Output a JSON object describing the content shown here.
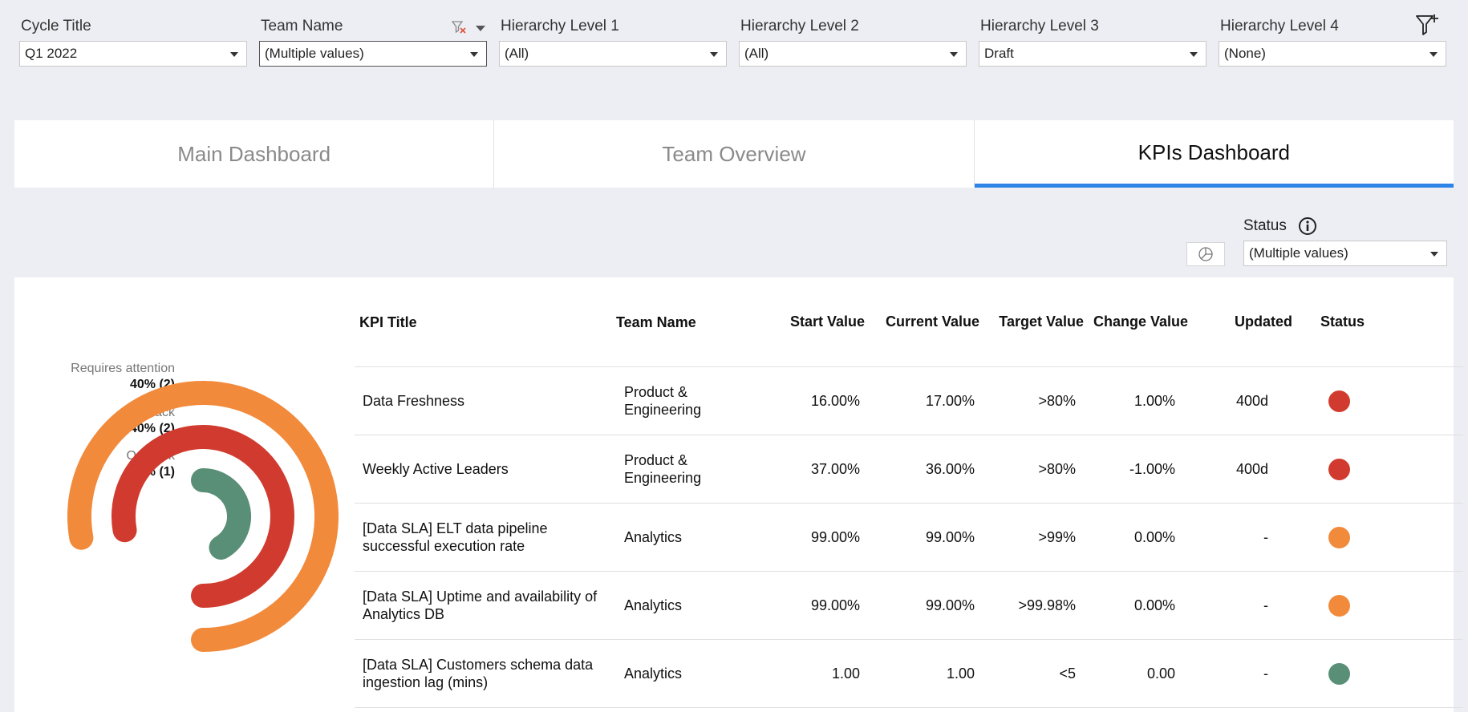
{
  "filters": [
    {
      "label": "Cycle Title",
      "value": "Q1 2022"
    },
    {
      "label": "Team Name",
      "value": "(Multiple values)"
    },
    {
      "label": "Hierarchy Level 1",
      "value": "(All)"
    },
    {
      "label": "Hierarchy Level 2",
      "value": "(All)"
    },
    {
      "label": "Hierarchy Level 3",
      "value": "Draft"
    },
    {
      "label": "Hierarchy Level 4",
      "value": "(None)"
    }
  ],
  "tabs": [
    {
      "label": "Main Dashboard",
      "active": false
    },
    {
      "label": "Team Overview",
      "active": false
    },
    {
      "label": "KPIs Dashboard",
      "active": true
    }
  ],
  "status_filter": {
    "label": "Status",
    "value": "(Multiple values)"
  },
  "colors": {
    "requires_attention": "#f28a3c",
    "off_track": "#d13b2f",
    "on_track": "#5a8f77",
    "tab_accent": "#2d83e6"
  },
  "chart_data": {
    "type": "radial-bar",
    "series": [
      {
        "name": "Requires attention",
        "label": "40% (2)",
        "percent": 40,
        "count": 2,
        "color": "#f28a3c"
      },
      {
        "name": "Off track",
        "label": "40% (2)",
        "percent": 40,
        "count": 2,
        "color": "#d13b2f"
      },
      {
        "name": "On track",
        "label": "20% (1)",
        "percent": 20,
        "count": 1,
        "color": "#5a8f77"
      }
    ]
  },
  "table": {
    "headers": {
      "title": "KPI Title",
      "team": "Team Name",
      "start": "Start Value",
      "current": "Current Value",
      "target": "Target Value",
      "change": "Change Value",
      "updated": "Updated",
      "status": "Status"
    },
    "rows": [
      {
        "title": "Data Freshness",
        "team": "Product & Engineering",
        "start": "16.00%",
        "current": "17.00%",
        "target": ">80%",
        "change": "1.00%",
        "updated": "400d",
        "status": "Off track",
        "color": "#d13b2f"
      },
      {
        "title": "Weekly Active Leaders",
        "team": "Product & Engineering",
        "start": "37.00%",
        "current": "36.00%",
        "target": ">80%",
        "change": "-1.00%",
        "updated": "400d",
        "status": "Off track",
        "color": "#d13b2f"
      },
      {
        "title": "[Data SLA] ELT data pipeline successful execution rate",
        "team": "Analytics",
        "start": "99.00%",
        "current": "99.00%",
        "target": ">99%",
        "change": "0.00%",
        "updated": "-",
        "status": "Requires attention",
        "color": "#f28a3c"
      },
      {
        "title": "[Data SLA] Uptime and availability of Analytics DB",
        "team": "Analytics",
        "start": "99.00%",
        "current": "99.00%",
        "target": ">99.98%",
        "change": "0.00%",
        "updated": "-",
        "status": "Requires attention",
        "color": "#f28a3c"
      },
      {
        "title": "[Data SLA] Customers schema data ingestion lag (mins)",
        "team": "Analytics",
        "start": "1.00",
        "current": "1.00",
        "target": "<5",
        "change": "0.00",
        "updated": "-",
        "status": "On track",
        "color": "#5a8f77"
      }
    ]
  }
}
